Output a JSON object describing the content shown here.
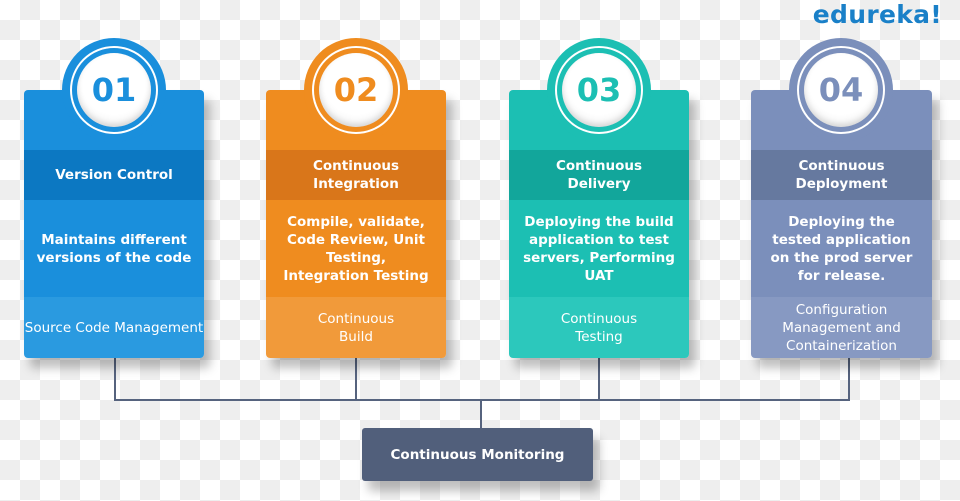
{
  "brand": {
    "logo_text": "edureka!"
  },
  "stages": [
    {
      "number": "01",
      "title": "Version Control",
      "description": "Maintains different versions of the code",
      "footer": "Source Code Management",
      "color": "#1a8fdc"
    },
    {
      "number": "02",
      "title": "Continuous Integration",
      "description": "Compile, validate, Code Review, Unit Testing, Integration Testing",
      "footer": "Continuous Build",
      "color": "#ef8c1f"
    },
    {
      "number": "03",
      "title": "Continuous Delivery",
      "description": "Deploying the build application to test servers, Performing UAT",
      "footer": "Continuous Testing",
      "color": "#1cbfb3"
    },
    {
      "number": "04",
      "title": "Continuous Deployment",
      "description": "Deploying the tested application on the prod server for release.",
      "footer": "Configuration Management and Containerization",
      "color": "#7b8fbb"
    }
  ],
  "monitoring": {
    "label": "Continuous Monitoring",
    "color": "#515f7b"
  }
}
